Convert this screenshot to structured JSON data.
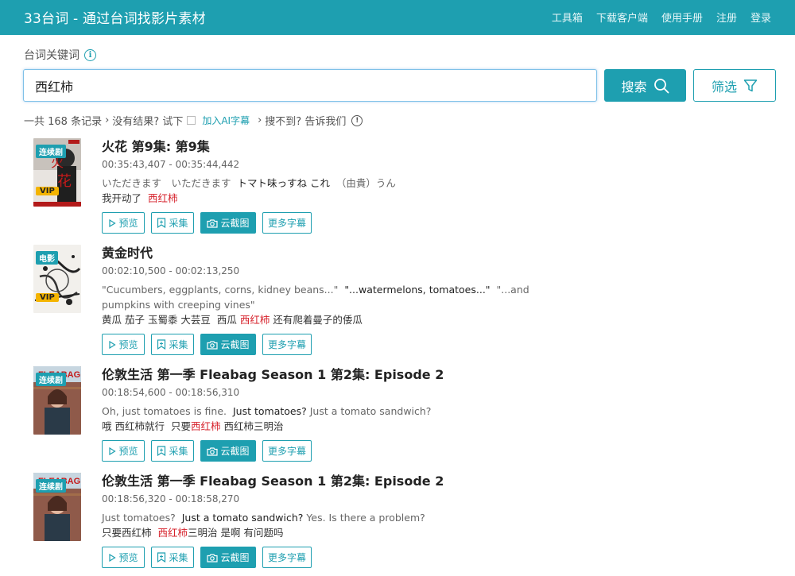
{
  "header": {
    "brand": "33台词 - 通过台词找影片素材",
    "nav": [
      "工具箱",
      "下载客户端",
      "使用手册",
      "注册",
      "登录"
    ]
  },
  "search": {
    "label": "台词关键词",
    "value": "西红柿",
    "search_label": "搜索",
    "filter_label": "筛选"
  },
  "stats": {
    "count_text": "一共 168 条记录",
    "no_result": "没有结果? 试下",
    "ai_link": "加入AI字幕",
    "not_found": "搜不到? 告诉我们"
  },
  "actions": [
    "预览",
    "采集",
    "云截图",
    "更多字幕"
  ],
  "colors": {
    "accent": "#1e9fb0",
    "highlight": "#d6202a",
    "vip": "#f4b400"
  },
  "results": [
    {
      "type": "连续剧",
      "vip": "VIP",
      "title": "火花 第9集: 第9集",
      "time": "00:35:43,407 - 00:35:44,442",
      "orig_a": "いただきます　いただきます",
      "orig_b": "トマト味っすね これ",
      "orig_c": "（由貴）うん",
      "trans_a": "我开动了",
      "trans_b": "西红柿",
      "trans_c": ""
    },
    {
      "type": "电影",
      "vip": "VIP",
      "title": "黄金时代",
      "time": "00:02:10,500 - 00:02:13,250",
      "orig_a": "\"Cucumbers, eggplants, corns, kidney beans...\"",
      "orig_b": "\"...watermelons, tomatoes...\"",
      "orig_c": "\"...and pumpkins with creeping vines\"",
      "trans_a": "黄瓜 茄子 玉蜀黍 大芸豆",
      "trans_a2": "西瓜",
      "trans_b": "西红柿",
      "trans_c": "还有爬着曼子的倭瓜"
    },
    {
      "type": "连续剧",
      "title": "伦敦生活 第一季 Fleabag Season 1 第2集: Episode 2",
      "time": "00:18:54,600 - 00:18:56,310",
      "orig_a": "Oh, just tomatoes is fine.",
      "orig_b": "Just tomatoes?",
      "orig_c": "Just a tomato sandwich?",
      "trans_a": "哦 西红柿就行",
      "trans_a2": "只要",
      "trans_b": "西红柿",
      "trans_c": "西红柿三明治"
    },
    {
      "type": "连续剧",
      "title": "伦敦生活 第一季 Fleabag Season 1 第2集: Episode 2",
      "time": "00:18:56,320 - 00:18:58,270",
      "orig_a": "Just tomatoes?",
      "orig_b": "Just a tomato sandwich?",
      "orig_c": "Yes. Is there a problem?",
      "trans_a": "只要西红柿",
      "trans_b": "西红柿",
      "trans_b2": "三明治",
      "trans_c": "是啊 有问题吗"
    }
  ]
}
